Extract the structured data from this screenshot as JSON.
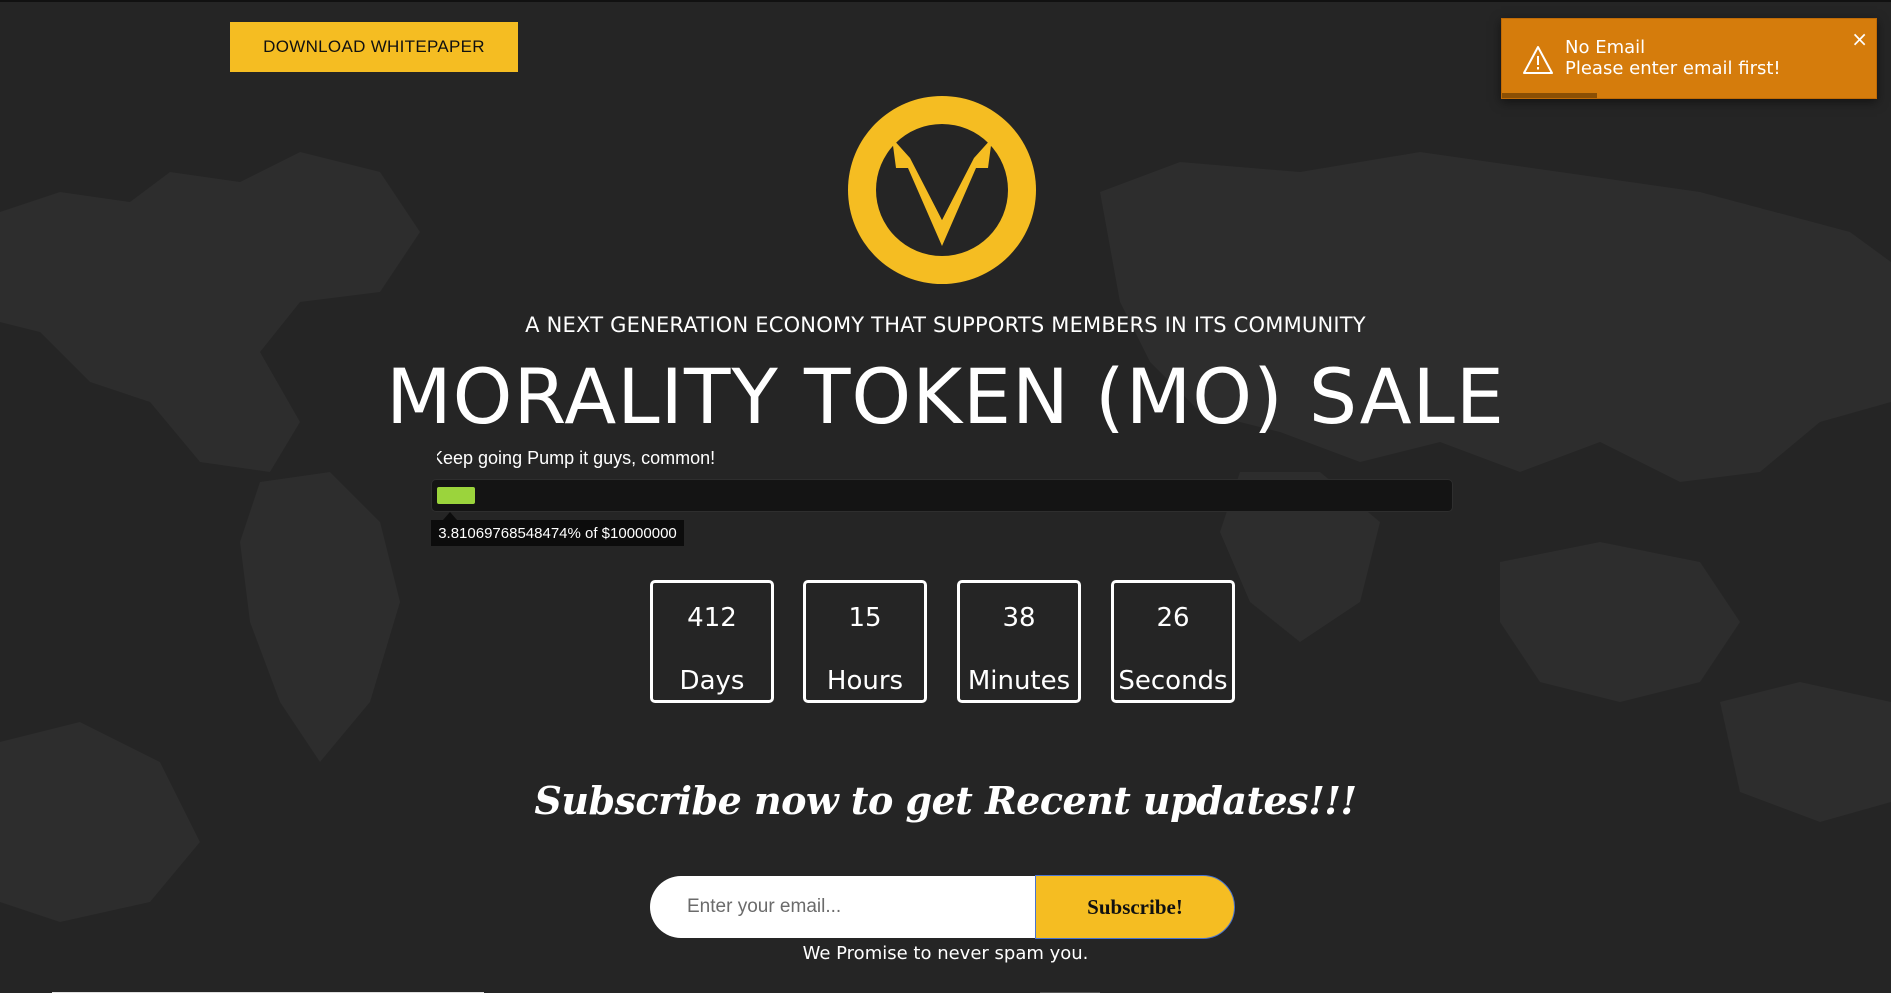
{
  "header": {
    "download_label": "DOWNLOAD WHITEPAPER"
  },
  "toast": {
    "title": "No Email",
    "message": "Please enter email first!",
    "close": "×",
    "color": "#d57c0c"
  },
  "hero": {
    "tagline": "A NEXT GENERATION ECONOMY THAT SUPPORTS MEMBERS IN ITS COMMUNITY",
    "title": "MORALITY TOKEN (MO) SALE"
  },
  "sale_progress": {
    "caption": "Keep going Pump it guys, common!",
    "percent": 3.81069768548474,
    "tooltip": "3.81069768548474% of $10000000",
    "bar_color": "#9bd43c"
  },
  "countdown": [
    {
      "value": "412",
      "unit": "Days"
    },
    {
      "value": "15",
      "unit": "Hours"
    },
    {
      "value": "38",
      "unit": "Minutes"
    },
    {
      "value": "26",
      "unit": "Seconds"
    }
  ],
  "subscribe": {
    "heading": "Subscribe now to get Recent updates!!!",
    "placeholder": "Enter your email...",
    "button_label": "Subscribe!",
    "promise": "We Promise to never spam you."
  },
  "colors": {
    "accent": "#f5bd22",
    "background": "#252525"
  }
}
